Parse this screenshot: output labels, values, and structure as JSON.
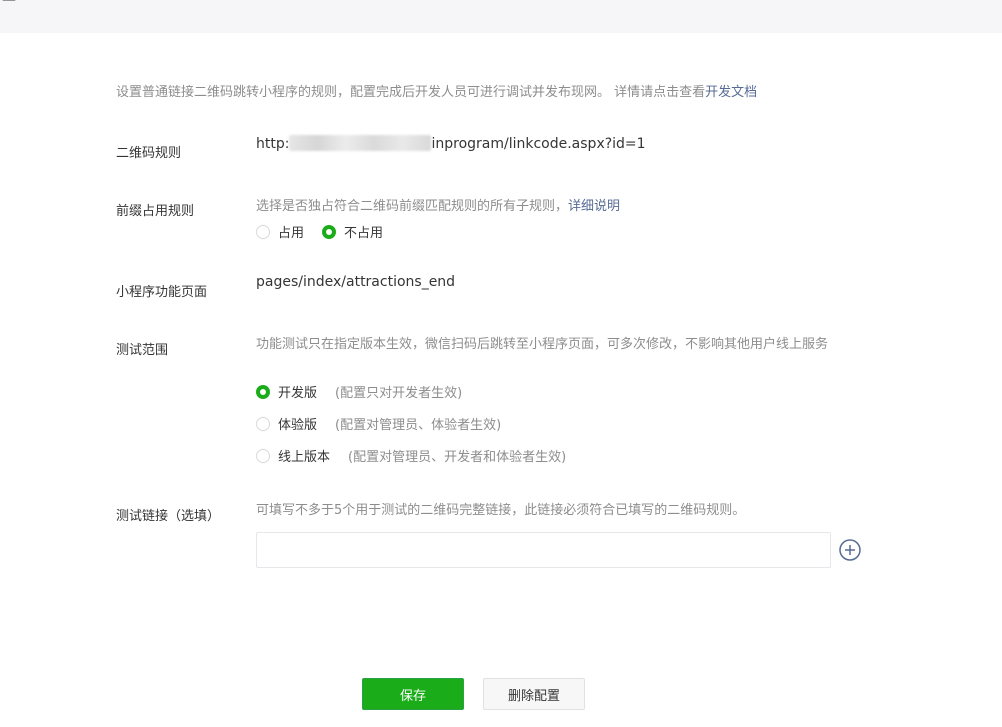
{
  "header": {
    "crumb": "— · ·· ·· ··"
  },
  "intro": {
    "text": "设置普通链接二维码跳转小程序的规则，配置完成后开发人员可进行调试并发布现网。 详情请点击查看",
    "link": "开发文档"
  },
  "qr_rule": {
    "label": "二维码规则",
    "prefix": "http:",
    "suffix": "inprogram/linkcode.aspx?id=1"
  },
  "prefix_rule": {
    "label": "前缀占用规则",
    "desc": "选择是否独占符合二维码前缀匹配规则的所有子规则，",
    "link": "详细说明",
    "options": [
      {
        "label": "占用",
        "checked": false
      },
      {
        "label": "不占用",
        "checked": true
      }
    ]
  },
  "page": {
    "label": "小程序功能页面",
    "value": "pages/index/attractions_end"
  },
  "test_scope": {
    "label": "测试范围",
    "desc": "功能测试只在指定版本生效，微信扫码后跳转至小程序页面，可多次修改，不影响其他用户线上服务",
    "options": [
      {
        "label": "开发版",
        "hint": "(配置只对开发者生效)",
        "checked": true
      },
      {
        "label": "体验版",
        "hint": "(配置对管理员、体验者生效)",
        "checked": false
      },
      {
        "label": "线上版本",
        "hint": "(配置对管理员、开发者和体验者生效)",
        "checked": false
      }
    ]
  },
  "test_link": {
    "label": "测试链接（选填）",
    "desc": "可填写不多于5个用于测试的二维码完整链接，此链接必须符合已填写的二维码规则。",
    "value": "",
    "placeholder": ""
  },
  "actions": {
    "save": "保存",
    "delete": "删除配置"
  },
  "colors": {
    "primary": "#1aad19",
    "link": "#576b95",
    "hint": "#8d8d8d"
  }
}
